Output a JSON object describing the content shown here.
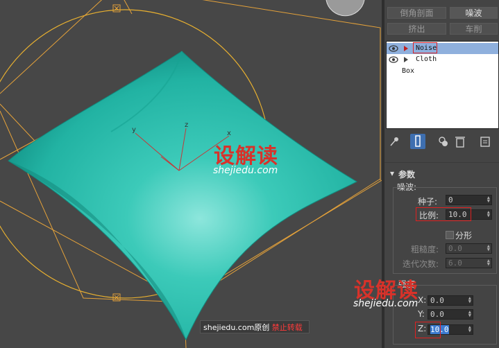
{
  "command_panel": {
    "buttons": {
      "chamfer": "倒角剖面",
      "noise": "噪波",
      "extrude": "挤出",
      "lathe": "车削"
    },
    "modifier_stack": [
      {
        "name": "Noise",
        "selected": true,
        "has_eye": true
      },
      {
        "name": "Cloth",
        "selected": false,
        "has_eye": true
      },
      {
        "name": "Box",
        "selected": false,
        "has_eye": false
      }
    ],
    "toolbar_icons": [
      "pin-stack-icon",
      "show-end-result-icon",
      "make-unique-icon",
      "remove-modifier-icon",
      "configure-modifier-sets-icon"
    ],
    "rollout_title": "参数",
    "noise_group_label": "噪波:",
    "seed_label": "种子:",
    "seed_value": "0",
    "scale_label": "比例:",
    "scale_value": "10.0",
    "fractal_label": "分形",
    "roughness_label": "粗糙度:",
    "roughness_value": "0.0",
    "iterations_label": "迭代次数:",
    "iterations_value": "6.0",
    "strength_group_label": "强度",
    "x_label": "X:",
    "x_value": "0.0",
    "y_label": "Y:",
    "y_value": "0.0",
    "z_label": "Z:",
    "z_value": "10.0"
  },
  "viewport": {
    "axis_x": "x",
    "axis_y": "y",
    "axis_z": "z",
    "object_color": "#1fb5a5",
    "gizmo_color": "#e5a23a"
  },
  "watermarks": {
    "brand_cn": "设解读",
    "brand_url": "shejiedu.com",
    "credit_prefix": "shejiedu.com原创",
    "credit_suffix": "禁止转载"
  }
}
